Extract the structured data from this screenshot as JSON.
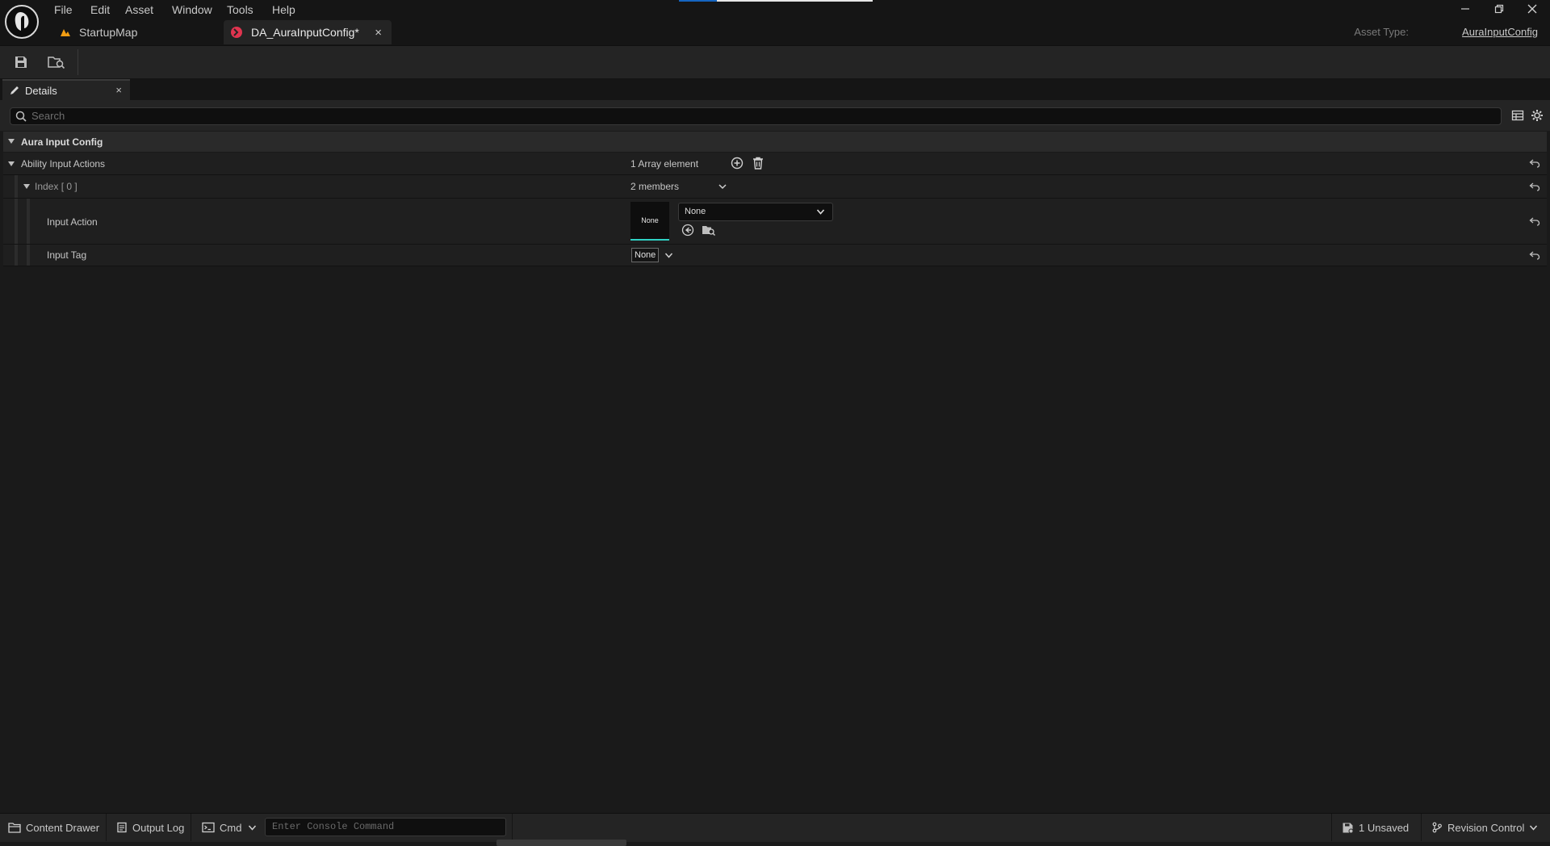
{
  "menu": {
    "items": [
      "File",
      "Edit",
      "Asset",
      "Window",
      "Tools",
      "Help"
    ]
  },
  "tabs": {
    "startup_map": "StartupMap",
    "asset": "DA_AuraInputConfig*",
    "close_glyph": "×"
  },
  "asset_type": {
    "label": "Asset Type:",
    "value": "AuraInputConfig"
  },
  "details": {
    "title": "Details",
    "close_glyph": "×"
  },
  "search": {
    "placeholder": "Search"
  },
  "properties": {
    "category": "Aura Input Config",
    "ability_input_actions": {
      "label": "Ability Input Actions",
      "value": "1 Array element"
    },
    "index": {
      "label": "Index [ 0 ]",
      "value": "2 members"
    },
    "input_action": {
      "label": "Input Action",
      "thumbnail_text": "None",
      "combo_value": "None"
    },
    "input_tag": {
      "label": "Input Tag",
      "value": "None"
    }
  },
  "statusbar": {
    "content_drawer": "Content Drawer",
    "output_log": "Output Log",
    "cmd": "Cmd",
    "console_placeholder": "Enter Console Command",
    "unsaved": "1 Unsaved",
    "revision_control": "Revision Control"
  },
  "colors": {
    "background": "#1a1a1a",
    "panel": "#242424",
    "titlebar": "#151515",
    "asset_tab_icon": "#e0344f",
    "map_icon": "#f29d12",
    "thumbnail_underline": "#2fd1c4",
    "progress": "#1565c0"
  },
  "icons": {
    "logo": "unreal-logo-icon",
    "save": "save-icon",
    "browse": "browse-to-asset-icon",
    "pencil": "pencil-icon",
    "search": "search-icon",
    "table_view": "table-view-icon",
    "settings": "gear-icon",
    "add": "add-element-icon",
    "delete": "trash-icon",
    "reset": "reset-to-default-icon"
  }
}
